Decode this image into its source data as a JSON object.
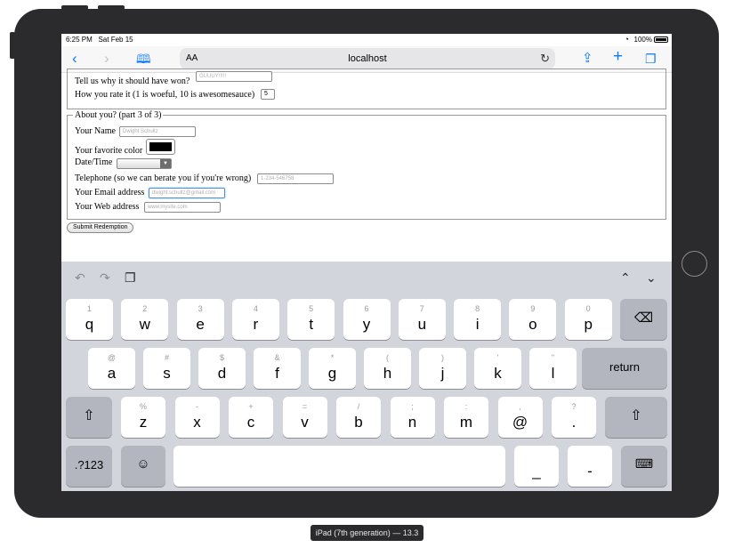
{
  "status_bar": {
    "time": "6:25 PM",
    "date": "Sat Feb 15",
    "battery": "100%"
  },
  "browser": {
    "text_size_label": "AA",
    "url": "localhost"
  },
  "form": {
    "won_label": "Tell us why it should have won?",
    "won_value": "GUUUY!!!!!",
    "rate_label": "How you rate it (1 is woeful, 10 is awesomesauce)",
    "rate_value": "5",
    "legend": "About you? (part 3 of 3)",
    "name_label": "Your Name",
    "name_placeholder": "Dwight Schultz",
    "color_label": "Your favorite color",
    "color_value": "#000000",
    "datetime_label": "Date/Time",
    "phone_label": "Telephone (so we can berate you if you're wrong)",
    "phone_placeholder": "1-234-546758",
    "email_label": "Your Email address",
    "email_placeholder": "dwight.schultz@gmail.com",
    "web_label": "Your Web address",
    "web_placeholder": "www.mysite.com",
    "submit_label": "Submit Redemption"
  },
  "keyboard": {
    "row1": [
      {
        "hint": "1",
        "key": "q"
      },
      {
        "hint": "2",
        "key": "w"
      },
      {
        "hint": "3",
        "key": "e"
      },
      {
        "hint": "4",
        "key": "r"
      },
      {
        "hint": "5",
        "key": "t"
      },
      {
        "hint": "6",
        "key": "y"
      },
      {
        "hint": "7",
        "key": "u"
      },
      {
        "hint": "8",
        "key": "i"
      },
      {
        "hint": "9",
        "key": "o"
      },
      {
        "hint": "0",
        "key": "p"
      }
    ],
    "row2": [
      {
        "hint": "@",
        "key": "a"
      },
      {
        "hint": "#",
        "key": "s"
      },
      {
        "hint": "$",
        "key": "d"
      },
      {
        "hint": "&",
        "key": "f"
      },
      {
        "hint": "*",
        "key": "g"
      },
      {
        "hint": "(",
        "key": "h"
      },
      {
        "hint": ")",
        "key": "j"
      },
      {
        "hint": "'",
        "key": "k"
      },
      {
        "hint": "\"",
        "key": "l"
      }
    ],
    "row3": [
      {
        "hint": "%",
        "key": "z"
      },
      {
        "hint": "-",
        "key": "x"
      },
      {
        "hint": "+",
        "key": "c"
      },
      {
        "hint": "=",
        "key": "v"
      },
      {
        "hint": "/",
        "key": "b"
      },
      {
        "hint": ";",
        "key": "n"
      },
      {
        "hint": ":",
        "key": "m"
      },
      {
        "hint": ",",
        "key": "@"
      },
      {
        "hint": "?",
        "key": "."
      }
    ],
    "return_label": "return",
    "numbers_label": ".?123",
    "underscore": "_",
    "dash": "-"
  },
  "device_label": "iPad (7th generation) — 13.3"
}
